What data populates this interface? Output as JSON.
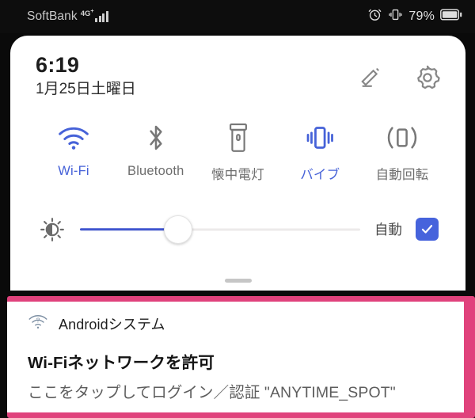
{
  "statusbar": {
    "carrier": "SoftBank",
    "network_type": "4G",
    "network_plus": "+",
    "signal_icon": "signal-bars-icon",
    "alarm_icon": "alarm-clock-icon",
    "vibrate_icon": "vibrate-icon",
    "battery_percent": "79%",
    "battery_icon": "battery-icon"
  },
  "quick_settings": {
    "time": "6:19",
    "date": "1月25日土曜日",
    "edit_icon": "pencil-edit-icon",
    "settings_icon": "gear-icon",
    "toggles": [
      {
        "label": "Wi-Fi",
        "icon": "wifi-icon",
        "active": true
      },
      {
        "label": "Bluetooth",
        "icon": "bluetooth-icon",
        "active": false
      },
      {
        "label": "懐中電灯",
        "icon": "flashlight-icon",
        "active": false
      },
      {
        "label": "バイブ",
        "icon": "vibrate-icon",
        "active": true
      },
      {
        "label": "自動回転",
        "icon": "auto-rotate-icon",
        "active": false
      }
    ],
    "brightness": {
      "icon": "brightness-icon",
      "value_percent": 35,
      "auto_label": "自動",
      "auto_checked": true,
      "check_icon": "check-icon"
    },
    "drag_handle": "drag-handle"
  },
  "notification": {
    "icon": "wifi-question-icon",
    "app_name": "Androidシステム",
    "title": "Wi-Fiネットワークを許可",
    "body": "ここをタップしてログイン／認証 \"ANYTIME_SPOT\"",
    "highlight_color": "#e0427c"
  },
  "colors": {
    "accent_blue": "#4663dc",
    "inactive_gray": "#6d6d6d",
    "highlight_pink": "#e0427c",
    "panel_bg": "#ffffff",
    "screen_bg": "#0a0a0a"
  }
}
